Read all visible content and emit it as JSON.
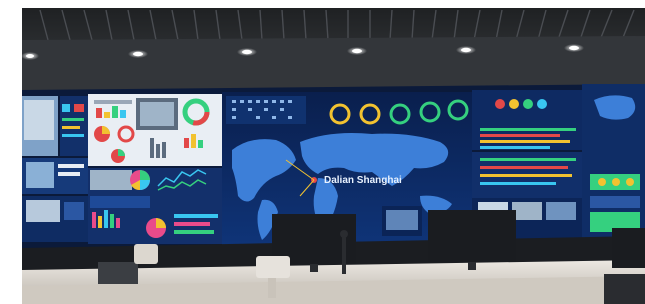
{
  "scene": {
    "subject": "control-room-video-wall",
    "colors": {
      "ceiling": "#2b2d30",
      "wall_panel_blue": "#0d2a63",
      "map_blue": "#1d63c9",
      "desk": "#d9d4cc",
      "accent_green": "#35d07f",
      "accent_red": "#e24848",
      "accent_yellow": "#f2c230",
      "accent_cyan": "#39c6f0"
    }
  },
  "wall": {
    "map_overlay_label": "Dalian Shanghai"
  }
}
